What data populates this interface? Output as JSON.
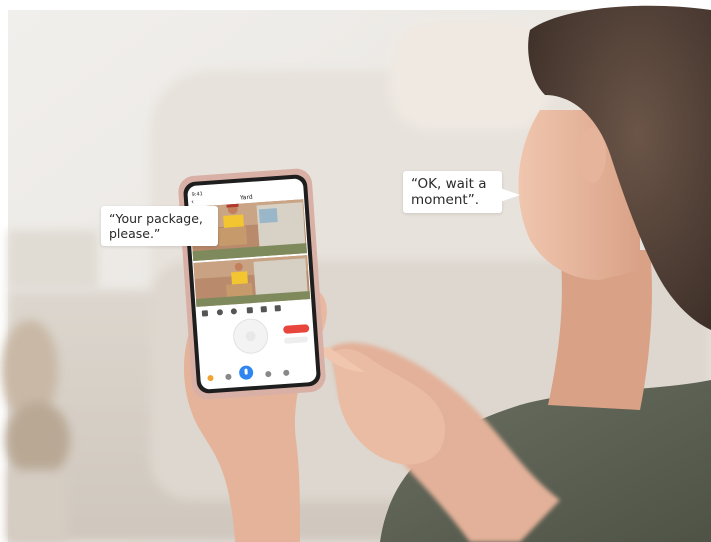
{
  "speech_bubbles": {
    "courier": {
      "lines": [
        "“Your package,",
        "please.”"
      ]
    },
    "resident": {
      "lines": [
        "“OK, wait a",
        "moment”."
      ]
    }
  },
  "phone_screen": {
    "status_time": "9:41",
    "app_title": "Yard",
    "talk_button_icon": "microphone-icon",
    "accent_color": "#2f86f0",
    "alert_color": "#e8453c"
  },
  "colors": {
    "wall": "#eeece8",
    "couch": "#e6e1da",
    "phone_case": "#d9b0a5",
    "sweater": "#5b6052",
    "skin": "#e9b9a0",
    "hair": "#4a3b33"
  }
}
